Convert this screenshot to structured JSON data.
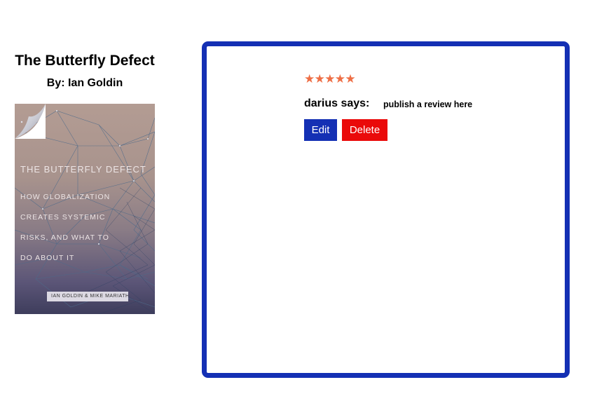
{
  "book": {
    "title": "The Butterfly Defect",
    "author_line": "By: Ian Goldin",
    "cover": {
      "title": "THE BUTTERFLY DEFECT",
      "subtitle_lines": [
        "HOW GLOBALIZATION",
        "CREATES SYSTEMIC",
        "RISKS, AND WHAT TO",
        "DO ABOUT IT"
      ],
      "authors": "IAN GOLDIN & MIKE MARIATHASAN"
    }
  },
  "review": {
    "rating": 5,
    "rating_max": 5,
    "star_color": "#ee6e45",
    "reviewer_line": "darius says:",
    "text": "publish a review here",
    "edit_label": "Edit",
    "delete_label": "Delete"
  },
  "colors": {
    "panel_border": "#1430b4",
    "edit_button": "#1430b4",
    "delete_button": "#ea0a0a"
  },
  "icons": {
    "star": "star-icon",
    "page_curl": "page-curl-icon"
  }
}
